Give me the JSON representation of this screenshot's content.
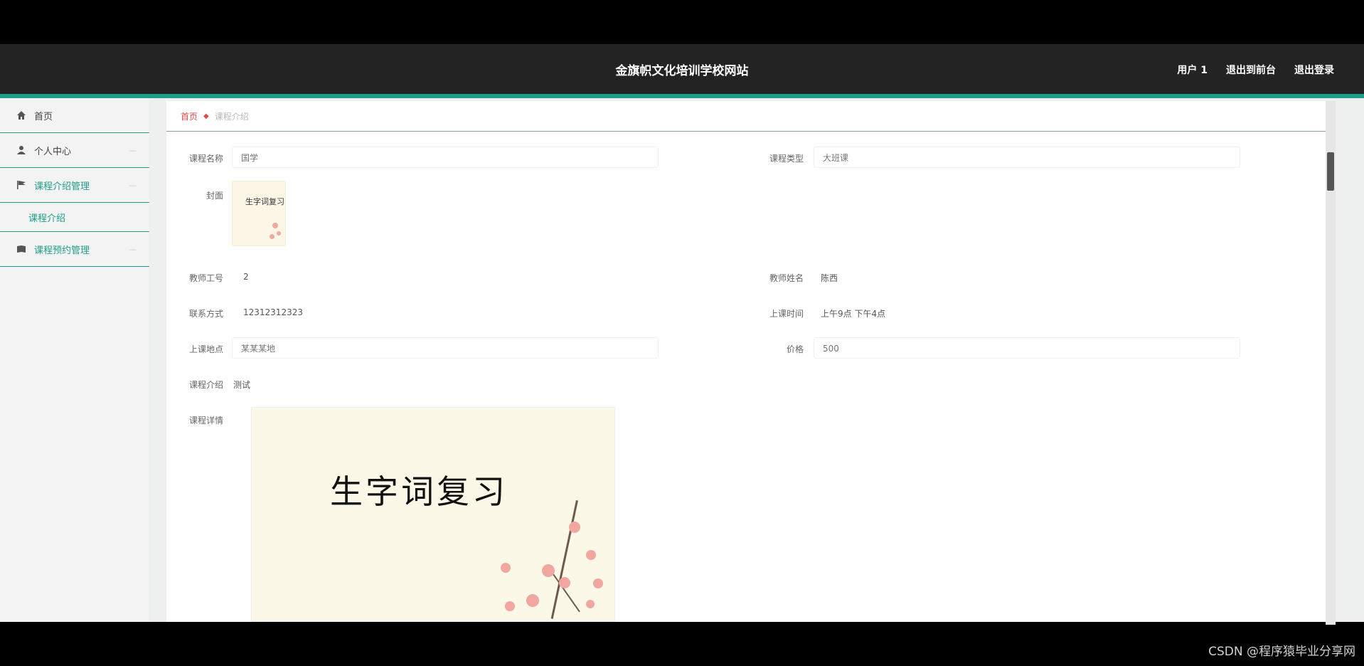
{
  "header": {
    "title": "金旗帜文化培训学校网站",
    "actions": [
      "用户 1",
      "退出到前台",
      "退出登录"
    ]
  },
  "sidebar": {
    "items": [
      {
        "label": "首页",
        "icon": "home-icon"
      },
      {
        "label": "个人中心",
        "icon": "user-icon"
      },
      {
        "label": "课程介绍管理",
        "icon": "flag-icon"
      },
      {
        "label": "课程介绍",
        "icon": ""
      },
      {
        "label": "课程预约管理",
        "icon": "book-icon"
      }
    ]
  },
  "breadcrumb": {
    "home": "首页",
    "current": "课程介绍"
  },
  "form": {
    "course_name_label": "课程名称",
    "course_name": "国学",
    "category_label": "课程类型",
    "category": "大班课",
    "cover_label": "封面",
    "teacher_no_label": "教师工号",
    "teacher_no": "2",
    "teacher_name_label": "教师姓名",
    "teacher_name": "陈西",
    "contact_label": "联系方式",
    "contact": "12312312323",
    "class_time_label": "上课时间",
    "class_time": "上午9点 下午4点",
    "location_label": "上课地点",
    "location": "某某某地",
    "price_label": "价格",
    "price": "500",
    "intro_label": "课程介绍",
    "intro": "测试",
    "detail_label": "课程详情",
    "cover_text": "生字词复习",
    "detail_image_text": "生字词复习"
  },
  "watermark": "CSDN @程序猿毕业分享网",
  "colors": {
    "accent": "#1f9e8a",
    "breadcrumb_home": "#e24a4a",
    "topbar": "#232323"
  }
}
